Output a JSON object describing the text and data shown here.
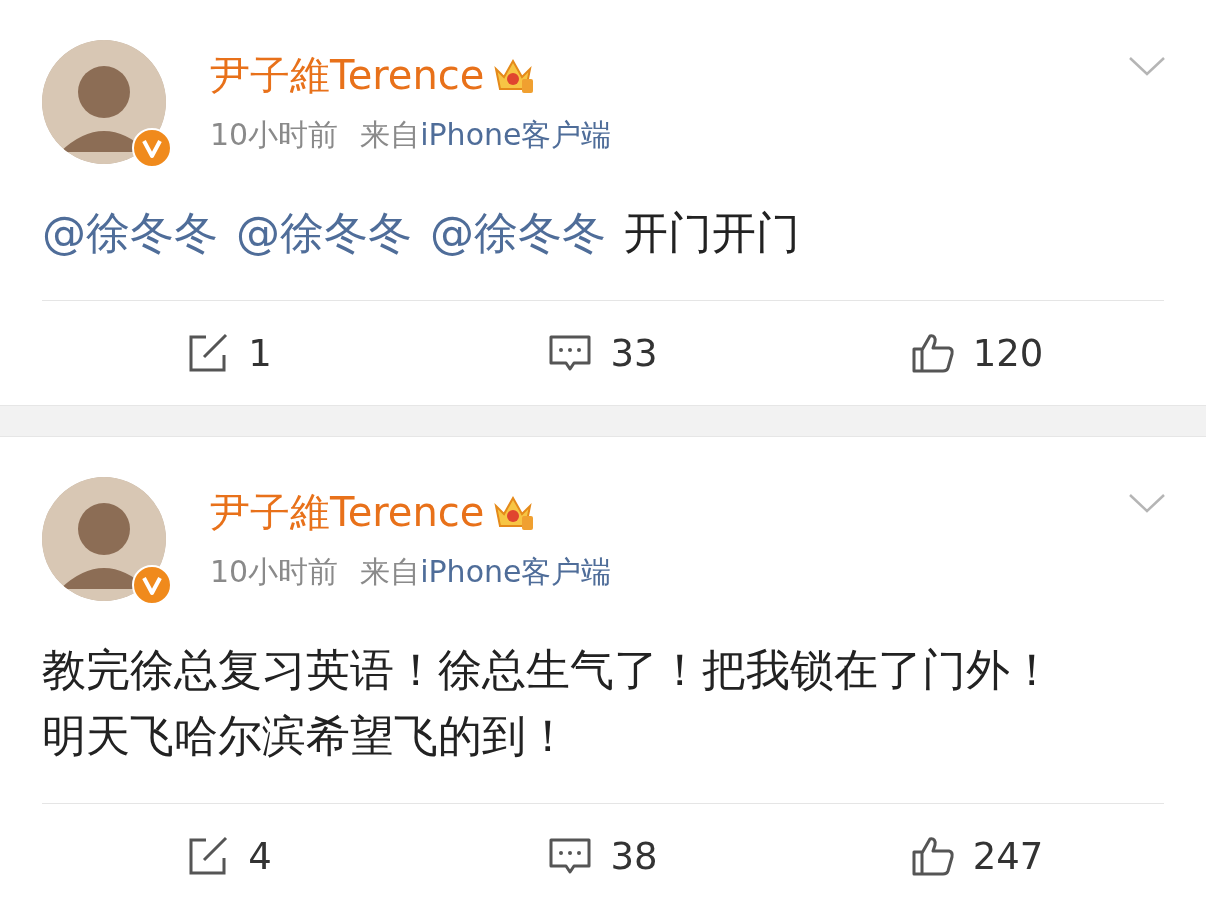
{
  "posts": [
    {
      "author": "尹子維Terence",
      "time": "10小时前",
      "source_prefix": "来自",
      "source": "iPhone客户端",
      "text": [
        {
          "kind": "mention",
          "text": "@徐冬冬"
        },
        {
          "kind": "mention",
          "text": "@徐冬冬"
        },
        {
          "kind": "mention",
          "text": "@徐冬冬"
        },
        {
          "kind": "plain",
          "text": "开门开门"
        }
      ],
      "reposts": "1",
      "comments": "33",
      "likes": "120"
    },
    {
      "author": "尹子維Terence",
      "time": "10小时前",
      "source_prefix": "来自",
      "source": "iPhone客户端",
      "text": [
        {
          "kind": "plain",
          "text": "教完徐总复习英语！徐总生气了！把我锁在了门外！明天飞哈尔滨希望飞的到！"
        }
      ],
      "reposts": "4",
      "comments": "38",
      "likes": "247"
    }
  ]
}
